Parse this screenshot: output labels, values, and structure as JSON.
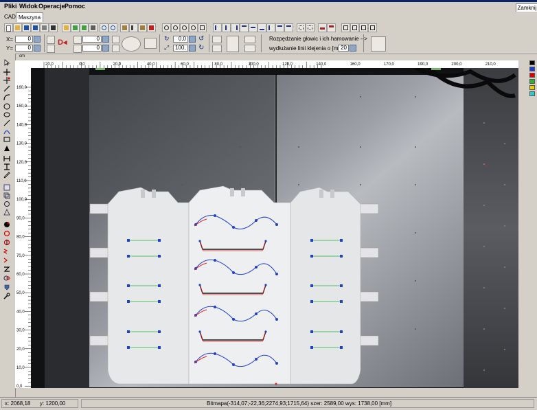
{
  "window": {
    "close_label": "Zamknij"
  },
  "menu": {
    "items": [
      "Pliki",
      "Widok",
      "Operacje",
      "Pomoc"
    ]
  },
  "tabs": [
    {
      "label": "CAD"
    },
    {
      "label": "Maszyna"
    }
  ],
  "toolbar2": {
    "x_label": "X=",
    "x_value": "0",
    "y_label": "Y=",
    "y_value": "0",
    "w_value": "0",
    "h_value": "0",
    "angle_value": "0,0",
    "scale_value": "100,0",
    "spread_text": "Rozpędzanie głowic i ich hamowanie -->",
    "extend_text": "wydłużanie linii klejenia o [mm] =",
    "extend_value": "20"
  },
  "ruler_top": {
    "unit": "cm",
    "labels": [
      "20,0",
      "0,0",
      "20,0",
      "40,0",
      "60,0",
      "80,0",
      "100,0",
      "120,0",
      "140,0",
      "160,0",
      "170,0",
      "190,0",
      "200,0",
      "210,0",
      "220,0"
    ]
  },
  "ruler_left": {
    "labels": [
      "160,0",
      "150,0",
      "140,0",
      "130,0",
      "120,0",
      "110,0",
      "100,0",
      "90,0",
      "80,0",
      "70,0",
      "60,0",
      "50,0",
      "40,0",
      "30,0",
      "20,0",
      "10,0",
      "0,0"
    ]
  },
  "palette": {
    "colors": [
      "#000000",
      "#1c3cd8",
      "#e00000",
      "#30b030",
      "#e8d000",
      "#2ec8d0"
    ]
  },
  "status": {
    "x": "x: 2068,18",
    "y": "y: 1200,00",
    "bitmap": "Bitmapa(-314,07;-22,36;2274,93;1715,64) szer: 2589,00 wys: 1738,00 [mm]"
  }
}
